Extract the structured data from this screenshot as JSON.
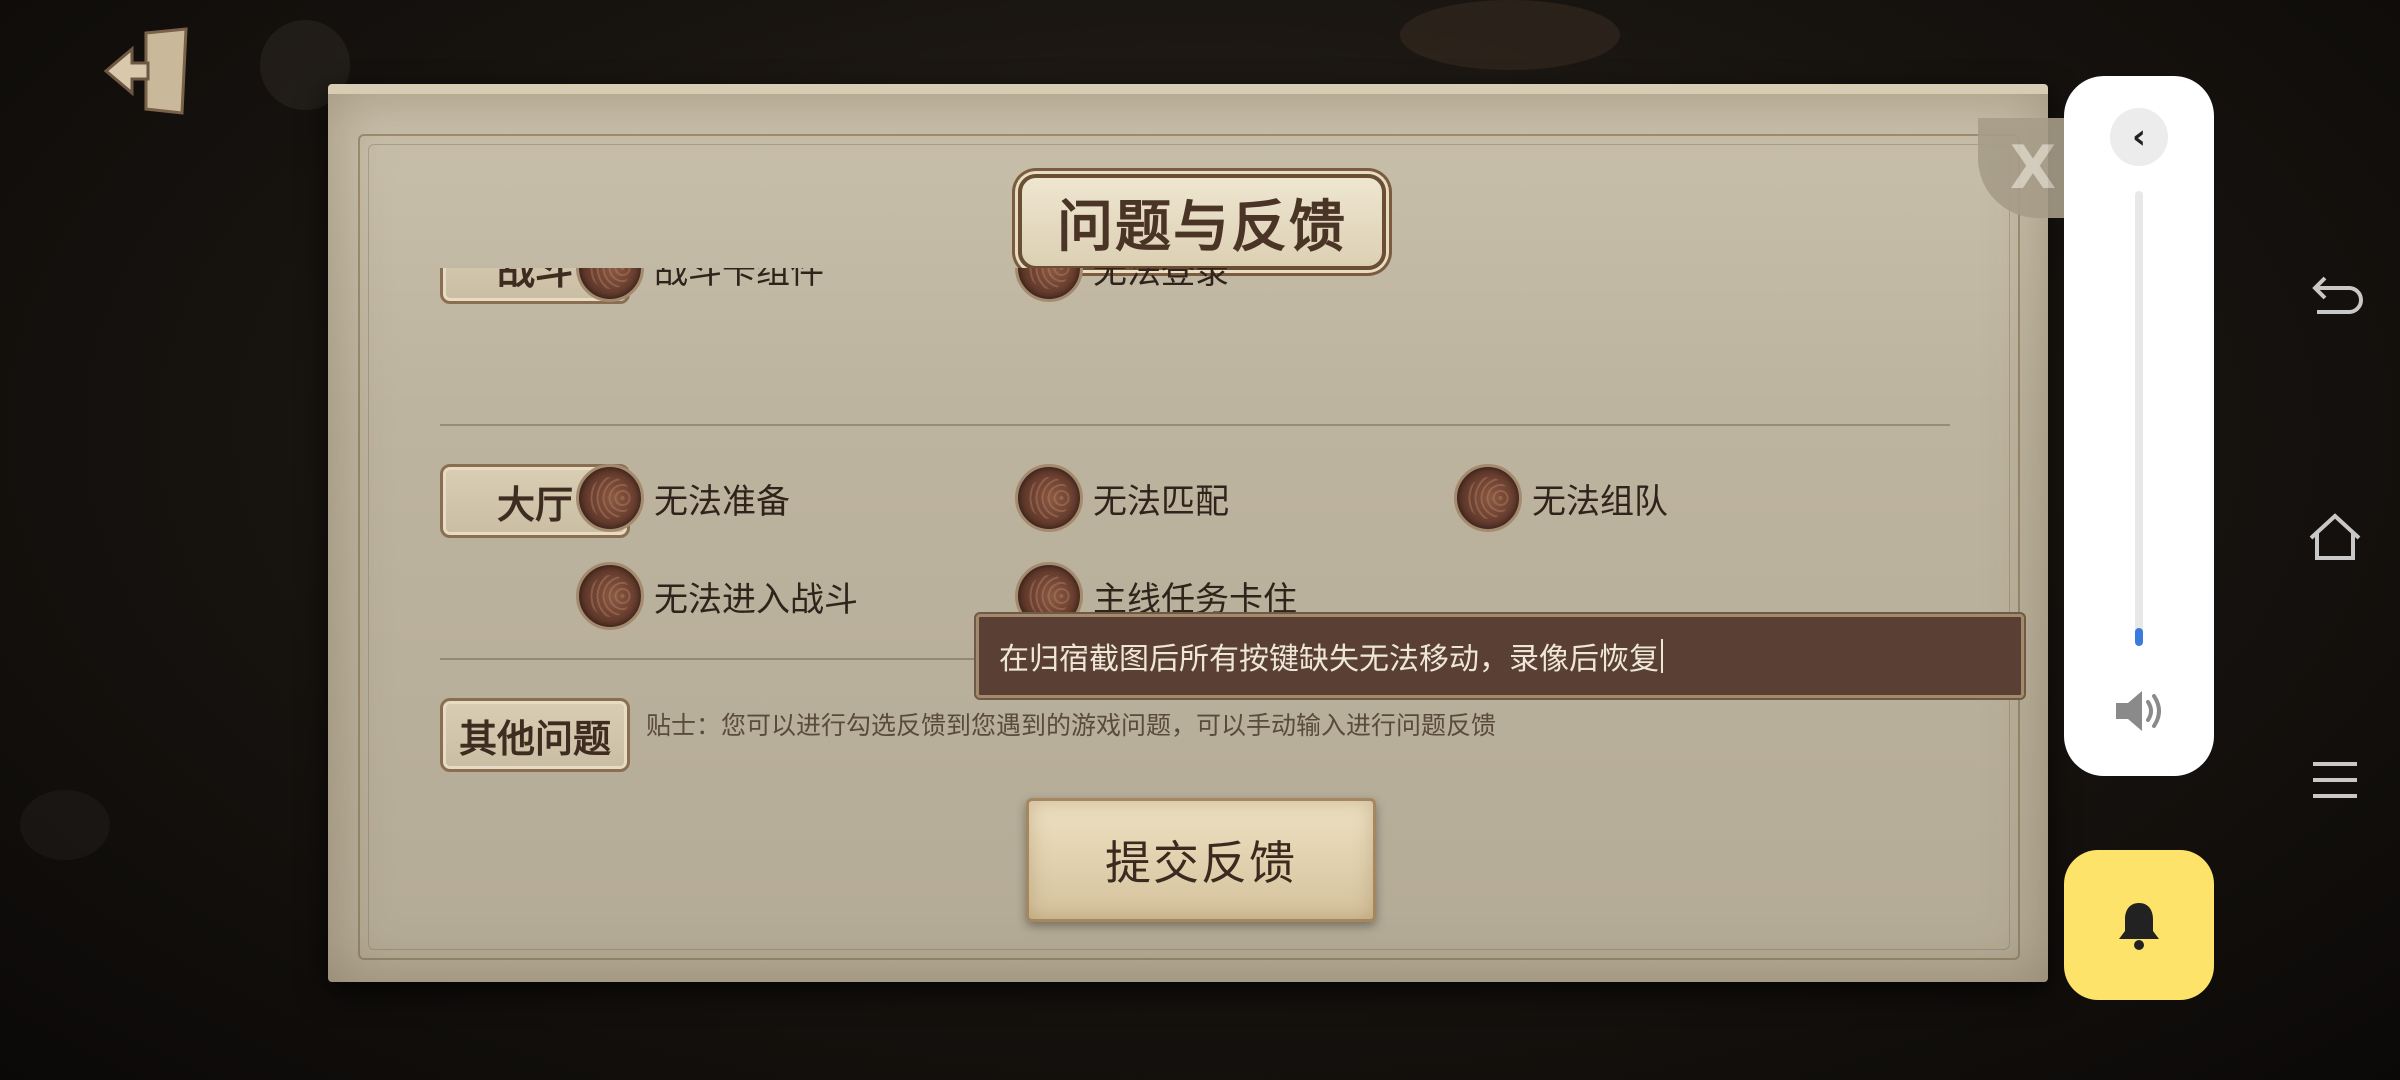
{
  "dialog": {
    "title": "问题与反馈",
    "close_label": "X"
  },
  "categories": [
    {
      "name": "战斗",
      "options": [
        "战斗卡组件",
        "无法登录"
      ]
    },
    {
      "name": "大厅",
      "options": [
        "无法准备",
        "无法匹配",
        "无法组队",
        "无法进入战斗",
        "主线任务卡住"
      ]
    }
  ],
  "other": {
    "label": "其他问题",
    "input_value": "在归宿截图后所有按键缺失无法移动，录像后恢复",
    "hint": "贴士：您可以进行勾选反馈到您遇到的游戏问题，可以手动输入进行问题反馈"
  },
  "submit_label": "提交反馈",
  "volume": {
    "level": 0.04,
    "back_icon": "chevron-left-icon",
    "speaker_icon": "speaker-icon"
  },
  "bell_icon": "bell-icon",
  "colors": {
    "volume_fill": "#3a7bdc",
    "bell_bg": "#fde36a",
    "input_bg": "#5a4034"
  }
}
